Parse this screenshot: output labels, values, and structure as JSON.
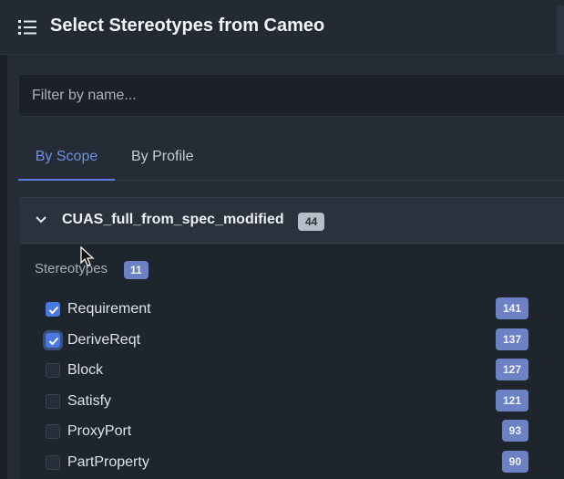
{
  "header": {
    "title": "Select Stereotypes from Cameo",
    "icon": "list-icon"
  },
  "filter": {
    "placeholder": "Filter by name...",
    "value": ""
  },
  "tabs": [
    {
      "label": "By Scope",
      "active": true
    },
    {
      "label": "By Profile",
      "active": false
    }
  ],
  "group": {
    "title": "CUAS_full_from_spec_modified",
    "count": "44",
    "expanded": true
  },
  "section": {
    "label": "Stereotypes",
    "count": "11"
  },
  "stereotypes": [
    {
      "label": "Requirement",
      "count": "141",
      "checked": true
    },
    {
      "label": "DeriveReqt",
      "count": "137",
      "checked": true
    },
    {
      "label": "Block",
      "count": "127",
      "checked": false
    },
    {
      "label": "Satisfy",
      "count": "121",
      "checked": false
    },
    {
      "label": "ProxyPort",
      "count": "93",
      "checked": false
    },
    {
      "label": "PartProperty",
      "count": "90",
      "checked": false
    }
  ],
  "colors": {
    "accent": "#5b7ce0",
    "badge": "#6d82c4",
    "checkbox": "#4a78e3"
  }
}
